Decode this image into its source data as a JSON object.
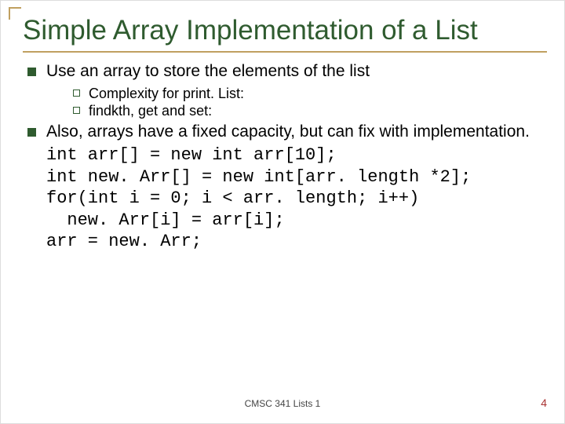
{
  "title": "Simple Array Implementation of a List",
  "points": [
    {
      "text": "Use an array to store the elements of the list",
      "sub": [
        "Complexity for print. List:",
        "findkth, get and set:"
      ]
    },
    {
      "text": "Also, arrays have a fixed capacity, but can fix with implementation.",
      "sub": []
    }
  ],
  "code": "int arr[] = new int arr[10];\nint new. Arr[] = new int[arr. length *2];\nfor(int i = 0; i < arr. length; i++)\n  new. Arr[i] = arr[i];\narr = new. Arr;",
  "footer": {
    "center": "CMSC 341 Lists 1",
    "page": "4"
  }
}
